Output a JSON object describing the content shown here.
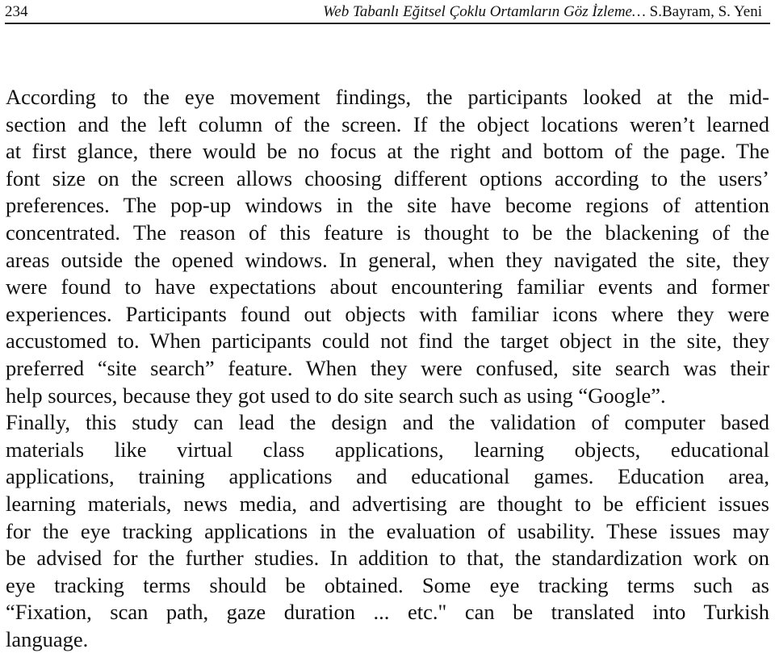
{
  "header": {
    "page_number": "234",
    "title": "Web Tabanlı Eğitsel Çoklu Ortamların Göz İzleme…",
    "authors": " S.Bayram, S. Yeni"
  },
  "body": {
    "lines": [
      "According to the eye movement findings, the participants looked at the mid-",
      "section and the left column of the screen. If the object locations weren’t learned",
      "at first glance, there would be no focus at the right and bottom of the page. The",
      "font size on the screen allows choosing different options according to the users’",
      "preferences. The pop-up windows in the site have become regions of attention",
      "concentrated. The reason of this feature is thought to be the blackening of the",
      "areas outside the opened windows. In general, when they navigated the site, they",
      "were found to have expectations about encountering familiar events and former",
      "experiences. Participants found out objects with familiar icons where they were",
      "accustomed to. When participants could not find the target object in the site, they",
      "preferred “site search” feature. When they were confused, site search was their",
      "help sources, because they got used to do site search such as using “Google”.",
      "Finally, this study can lead the design and the validation of computer based",
      "materials like virtual class applications, learning objects, educational",
      "applications, training applications and educational games. Education area,",
      "learning materials, news media, and advertising are thought to be efficient issues",
      "for the eye tracking applications in the evaluation of usability. These issues may",
      "be advised for the further studies. In addition to that, the standardization work on",
      "eye tracking terms should be obtained. Some eye tracking terms such as",
      "“Fixation, scan path, gaze duration ... etc.\" can be translated into Turkish",
      "language."
    ]
  }
}
